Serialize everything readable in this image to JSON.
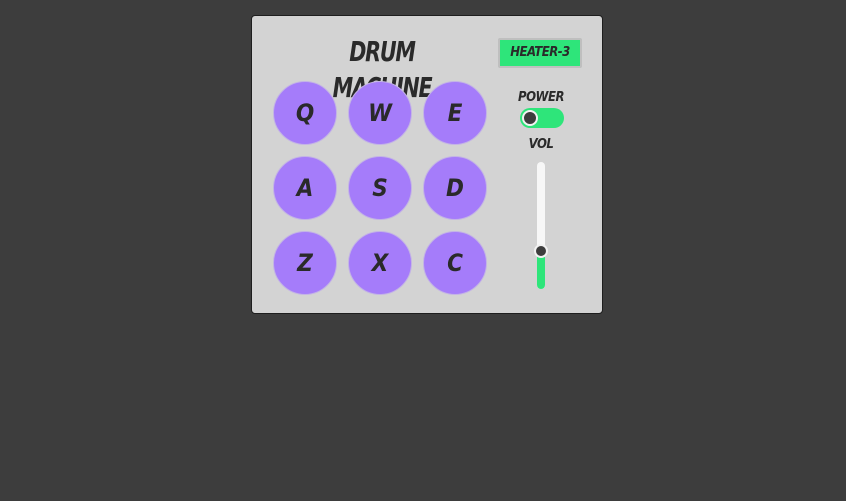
{
  "title": "DRUM MACHINE",
  "display": "HEATER-3",
  "pads": [
    {
      "key": "Q"
    },
    {
      "key": "W"
    },
    {
      "key": "E"
    },
    {
      "key": "A"
    },
    {
      "key": "S"
    },
    {
      "key": "D"
    },
    {
      "key": "Z"
    },
    {
      "key": "X"
    },
    {
      "key": "C"
    }
  ],
  "controls": {
    "power_label": "POWER",
    "power_on": true,
    "volume_label": "VOL",
    "volume_level": 0.3
  },
  "colors": {
    "background": "#3d3d3d",
    "panel": "#d3d3d3",
    "pad": "#a57cfa",
    "accent": "#2ee57a"
  }
}
